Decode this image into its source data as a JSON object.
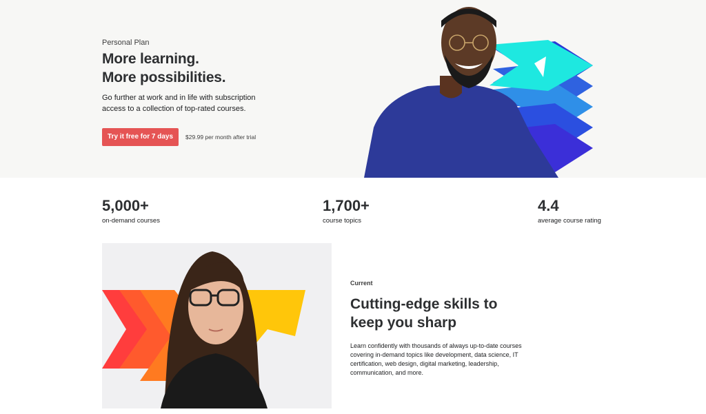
{
  "hero": {
    "eyebrow": "Personal Plan",
    "title_line1": "More learning.",
    "title_line2": "More possibilities.",
    "subtitle": "Go further at work and in life with subscription access to a collection of top-rated courses.",
    "cta_label": "Try it free for 7 days",
    "cta_note": "$29.99 per month after trial",
    "cta_color": "#e55454"
  },
  "stats": [
    {
      "value": "5,000+",
      "label": "on-demand courses"
    },
    {
      "value": "1,700+",
      "label": "course topics"
    },
    {
      "value": "4.4",
      "label": "average course rating"
    }
  ],
  "feature": {
    "eyebrow": "Current",
    "title_line1": "Cutting-edge skills to",
    "title_line2": "keep you sharp",
    "body": "Learn confidently with thousands of always up-to-date courses covering in-demand topics like development, data science, IT certification, web design, digital marketing, leadership, communication, and more."
  },
  "colors": {
    "hero_bg": "#f7f7f5",
    "chevron_cyan": "#1ee8e0",
    "chevron_blue": "#2e5bd8",
    "chevron_red": "#ff4040",
    "chevron_yellow": "#ffc60a"
  }
}
